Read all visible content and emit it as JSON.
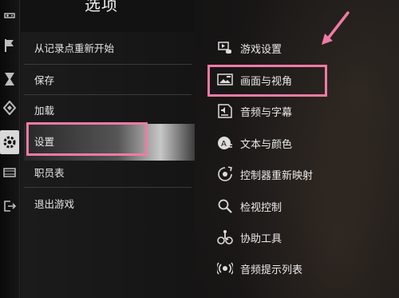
{
  "title": "选项",
  "colors": {
    "highlight": "#f07aa6",
    "text": "#e8e8e8",
    "background": "#121212"
  },
  "rail_icons": [
    "controller-icon",
    "flag-icon",
    "hourglass-icon",
    "diamond-icon",
    "gear-icon",
    "film-icon",
    "exit-icon"
  ],
  "left_menu": [
    {
      "label": "从记录点重新开始"
    },
    {
      "label": "保存"
    },
    {
      "label": "加载"
    },
    {
      "label": "设置"
    },
    {
      "label": "职员表"
    },
    {
      "label": "退出游戏"
    }
  ],
  "right_menu": [
    {
      "label": "游戏设置",
      "icon": "gamepad-settings-icon"
    },
    {
      "label": "画面与视角",
      "icon": "display-icon"
    },
    {
      "label": "音频与字幕",
      "icon": "audio-icon"
    },
    {
      "label": "文本与颜色",
      "icon": "text-color-icon"
    },
    {
      "label": "控制器重新映射",
      "icon": "remap-icon"
    },
    {
      "label": "检视控制",
      "icon": "inspect-icon"
    },
    {
      "label": "协助工具",
      "icon": "assist-icon"
    },
    {
      "label": "音频提示列表",
      "icon": "audio-cue-icon"
    }
  ]
}
